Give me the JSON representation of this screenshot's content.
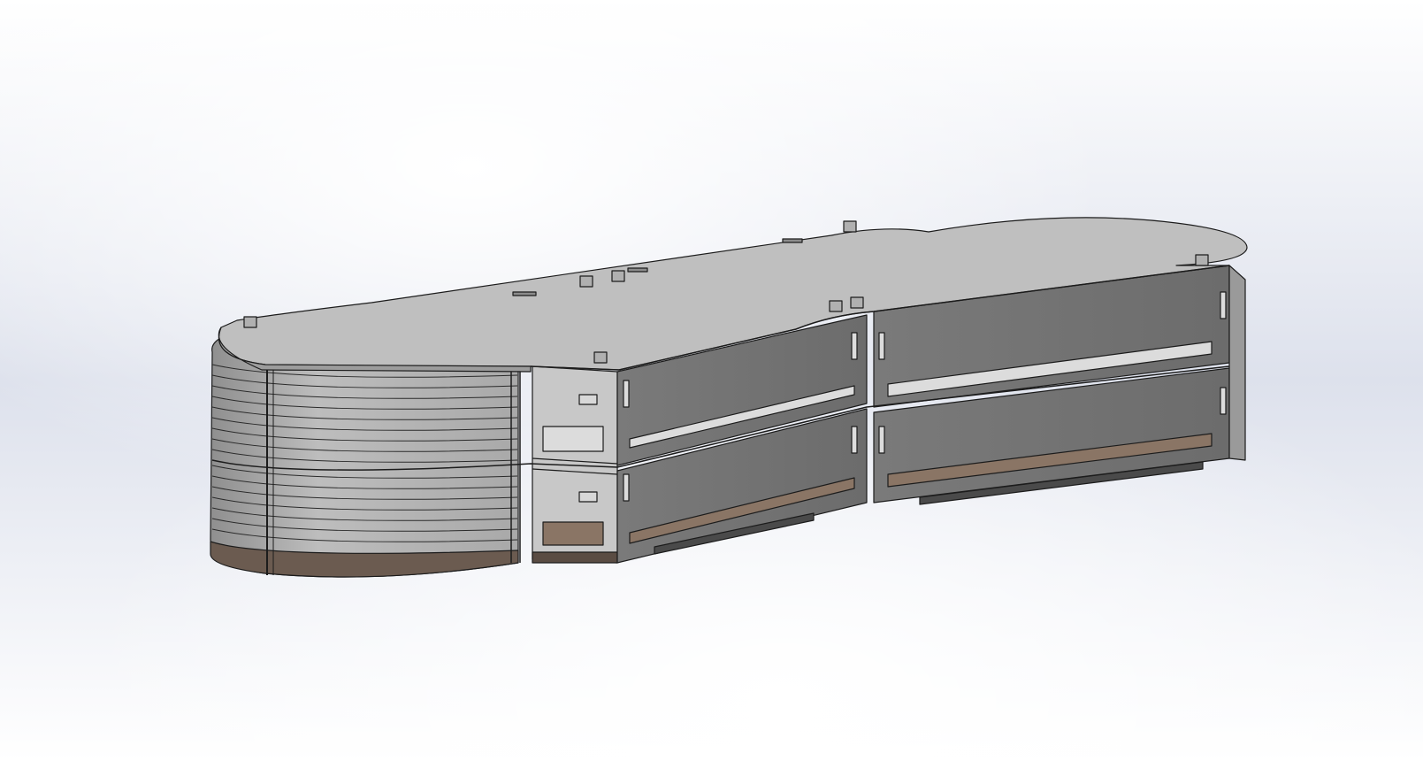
{
  "viewport": {
    "background_top": "#ffffff",
    "background_mid": "#dde1ec",
    "background_bottom": "#ffffff"
  },
  "model": {
    "colors": {
      "top_face": "#bfbfbf",
      "outline": "#1c1c1c",
      "light_wall": "#c8c8c8",
      "wall_face": "#9a9a9a",
      "side_panel": "#777777",
      "inner_slot": "#dcdcdc",
      "dark_slot": "#4a4a4a",
      "base_plate": "#6b5b50",
      "base_plate_light": "#8a7565"
    }
  }
}
